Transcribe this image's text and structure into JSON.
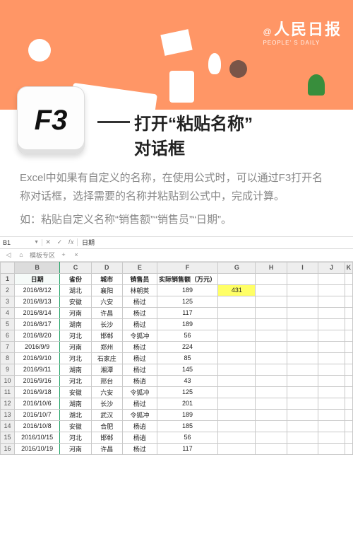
{
  "brand": {
    "at": "@",
    "cn": "人民日报",
    "en": "PEOPLE' S DAILY"
  },
  "keycap": "F3",
  "title": {
    "dash": "——",
    "l1": "打开“粘贴名称”",
    "l2": "对话框"
  },
  "desc": {
    "p1": "Excel中如果有自定义的名称，在使用公式时，可以通过F3打开名称对话框，选择需要的名称并粘贴到公式中，完成计算。",
    "p2": "如：粘贴自定义名称“销售额”“销售员”“日期”。"
  },
  "excel": {
    "namebox": "B1",
    "fx_value": "日期",
    "toolbar_label": "模板专区",
    "columns": [
      "B",
      "C",
      "D",
      "E",
      "F",
      "G",
      "H",
      "I",
      "J",
      "K"
    ],
    "headers": {
      "B": "日期",
      "C": "省份",
      "D": "城市",
      "E": "销售员",
      "F": "实际销售额（万元）"
    },
    "result": "431",
    "rows": [
      {
        "n": 2,
        "B": "2016/8/12",
        "C": "湖北",
        "D": "襄阳",
        "E": "林朝英",
        "F": "189"
      },
      {
        "n": 3,
        "B": "2016/8/13",
        "C": "安徽",
        "D": "六安",
        "E": "杨过",
        "F": "125"
      },
      {
        "n": 4,
        "B": "2016/8/14",
        "C": "河南",
        "D": "许昌",
        "E": "杨过",
        "F": "117"
      },
      {
        "n": 5,
        "B": "2016/8/17",
        "C": "湖南",
        "D": "长沙",
        "E": "杨过",
        "F": "189"
      },
      {
        "n": 6,
        "B": "2016/8/20",
        "C": "河北",
        "D": "邯郸",
        "E": "令狐冲",
        "F": "56"
      },
      {
        "n": 7,
        "B": "2016/9/9",
        "C": "河南",
        "D": "郑州",
        "E": "杨过",
        "F": "224"
      },
      {
        "n": 8,
        "B": "2016/9/10",
        "C": "河北",
        "D": "石家庄",
        "E": "杨过",
        "F": "85"
      },
      {
        "n": 9,
        "B": "2016/9/11",
        "C": "湖南",
        "D": "湘潭",
        "E": "杨过",
        "F": "145"
      },
      {
        "n": 10,
        "B": "2016/9/16",
        "C": "河北",
        "D": "邢台",
        "E": "杨逍",
        "F": "43"
      },
      {
        "n": 11,
        "B": "2016/9/18",
        "C": "安徽",
        "D": "六安",
        "E": "令狐冲",
        "F": "125"
      },
      {
        "n": 12,
        "B": "2016/10/6",
        "C": "湖南",
        "D": "长沙",
        "E": "杨过",
        "F": "201"
      },
      {
        "n": 13,
        "B": "2016/10/7",
        "C": "湖北",
        "D": "武汉",
        "E": "令狐冲",
        "F": "189"
      },
      {
        "n": 14,
        "B": "2016/10/8",
        "C": "安徽",
        "D": "合肥",
        "E": "杨逍",
        "F": "185"
      },
      {
        "n": 15,
        "B": "2016/10/15",
        "C": "河北",
        "D": "邯郸",
        "E": "杨逍",
        "F": "56"
      },
      {
        "n": 16,
        "B": "2016/10/19",
        "C": "河南",
        "D": "许昌",
        "E": "杨过",
        "F": "117"
      }
    ]
  }
}
